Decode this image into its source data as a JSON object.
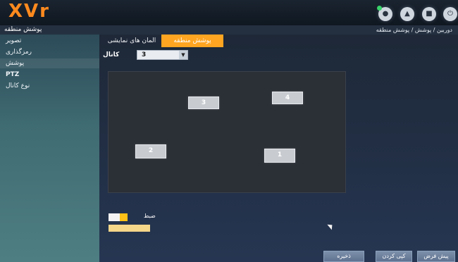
{
  "header": {
    "logo": "XVr",
    "icons": [
      {
        "name": "view-icon",
        "glyph": "●"
      },
      {
        "name": "user-icon",
        "glyph": "▲"
      },
      {
        "name": "screen-icon",
        "glyph": "■"
      },
      {
        "name": "power-icon",
        "glyph": "⏻"
      }
    ]
  },
  "title": {
    "page_title": "پوشش منطقه",
    "breadcrumb": "دوربین / پوشش / پوشش منطقه"
  },
  "sidebar": {
    "items": [
      {
        "label": "تصویر"
      },
      {
        "label": "رمزگذاری"
      },
      {
        "label": "پوشش"
      },
      {
        "label": "PTZ"
      },
      {
        "label": "نوع کانال"
      }
    ]
  },
  "tabs": {
    "effects": "المان های نمایشی",
    "mask": "پوشش منطقه"
  },
  "channel": {
    "label": "کانال",
    "value": "3"
  },
  "masks": [
    "3",
    "4",
    "2",
    "1"
  ],
  "legend": {
    "label": "ضبط"
  },
  "buttons": {
    "default": "پیش فرض",
    "default2": "کپی کردن",
    "apply": "ذخیره"
  },
  "colors": {
    "logo": "#ff8a1e",
    "active_tab": "#ffa521",
    "status_dot": "#39d36a"
  }
}
